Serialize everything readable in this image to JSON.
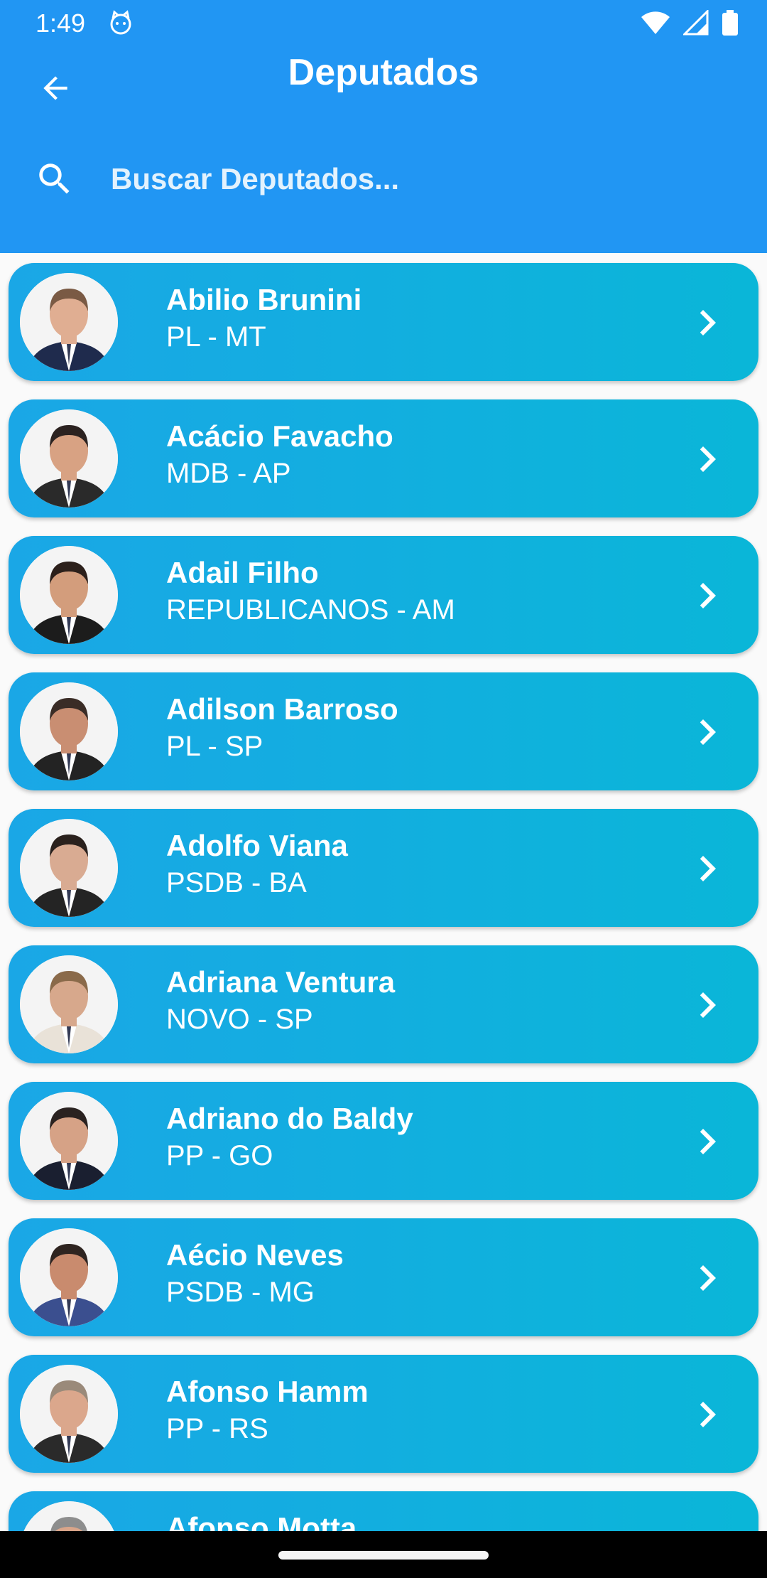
{
  "status_bar": {
    "time": "1:49",
    "icons": [
      "cat-face-icon",
      "wifi-icon",
      "signal-icon",
      "battery-icon"
    ]
  },
  "header": {
    "title": "Deputados",
    "back_icon": "arrow-back-icon"
  },
  "search": {
    "placeholder": "Buscar Deputados...",
    "value": "",
    "icon": "search-icon"
  },
  "deputies": [
    {
      "name": "Abilio Brunini",
      "party": "PL - MT",
      "skin": "#e0ae92",
      "hair": "#7a5a44",
      "suit": "#1f2b4d"
    },
    {
      "name": "Acácio Favacho",
      "party": "MDB - AP",
      "skin": "#d8a283",
      "hair": "#2b2220",
      "suit": "#2a2a2a"
    },
    {
      "name": "Adail Filho",
      "party": "REPUBLICANOS - AM",
      "skin": "#d39d7c",
      "hair": "#2c201b",
      "suit": "#1c1c1c"
    },
    {
      "name": "Adilson Barroso",
      "party": "PL - SP",
      "skin": "#c98e72",
      "hair": "#3a2c26",
      "suit": "#232323"
    },
    {
      "name": "Adolfo Viana",
      "party": "PSDB - BA",
      "skin": "#d9ab92",
      "hair": "#2a211d",
      "suit": "#242424"
    },
    {
      "name": "Adriana Ventura",
      "party": "NOVO - SP",
      "skin": "#d7a88c",
      "hair": "#8a6a4a",
      "suit": "#e9e2d8"
    },
    {
      "name": "Adriano do Baldy",
      "party": "PP - GO",
      "skin": "#d6a286",
      "hair": "#2a2220",
      "suit": "#1a1f30"
    },
    {
      "name": "Aécio Neves",
      "party": "PSDB - MG",
      "skin": "#c98b6e",
      "hair": "#2e2420",
      "suit": "#3b4f8f"
    },
    {
      "name": "Afonso Hamm",
      "party": "PP - RS",
      "skin": "#dba78c",
      "hair": "#9a8a7a",
      "suit": "#2a2a2a"
    },
    {
      "name": "Afonso Motta",
      "party": "",
      "skin": "#d9a58a",
      "hair": "#8d8d8d",
      "suit": "#2a2a2a"
    }
  ],
  "colors": {
    "appbar": "#2196f3",
    "card_start": "#1aa7e6",
    "card_end": "#0ab6d8",
    "text": "#ffffff"
  },
  "chevron_icon": "chevron-right-icon"
}
